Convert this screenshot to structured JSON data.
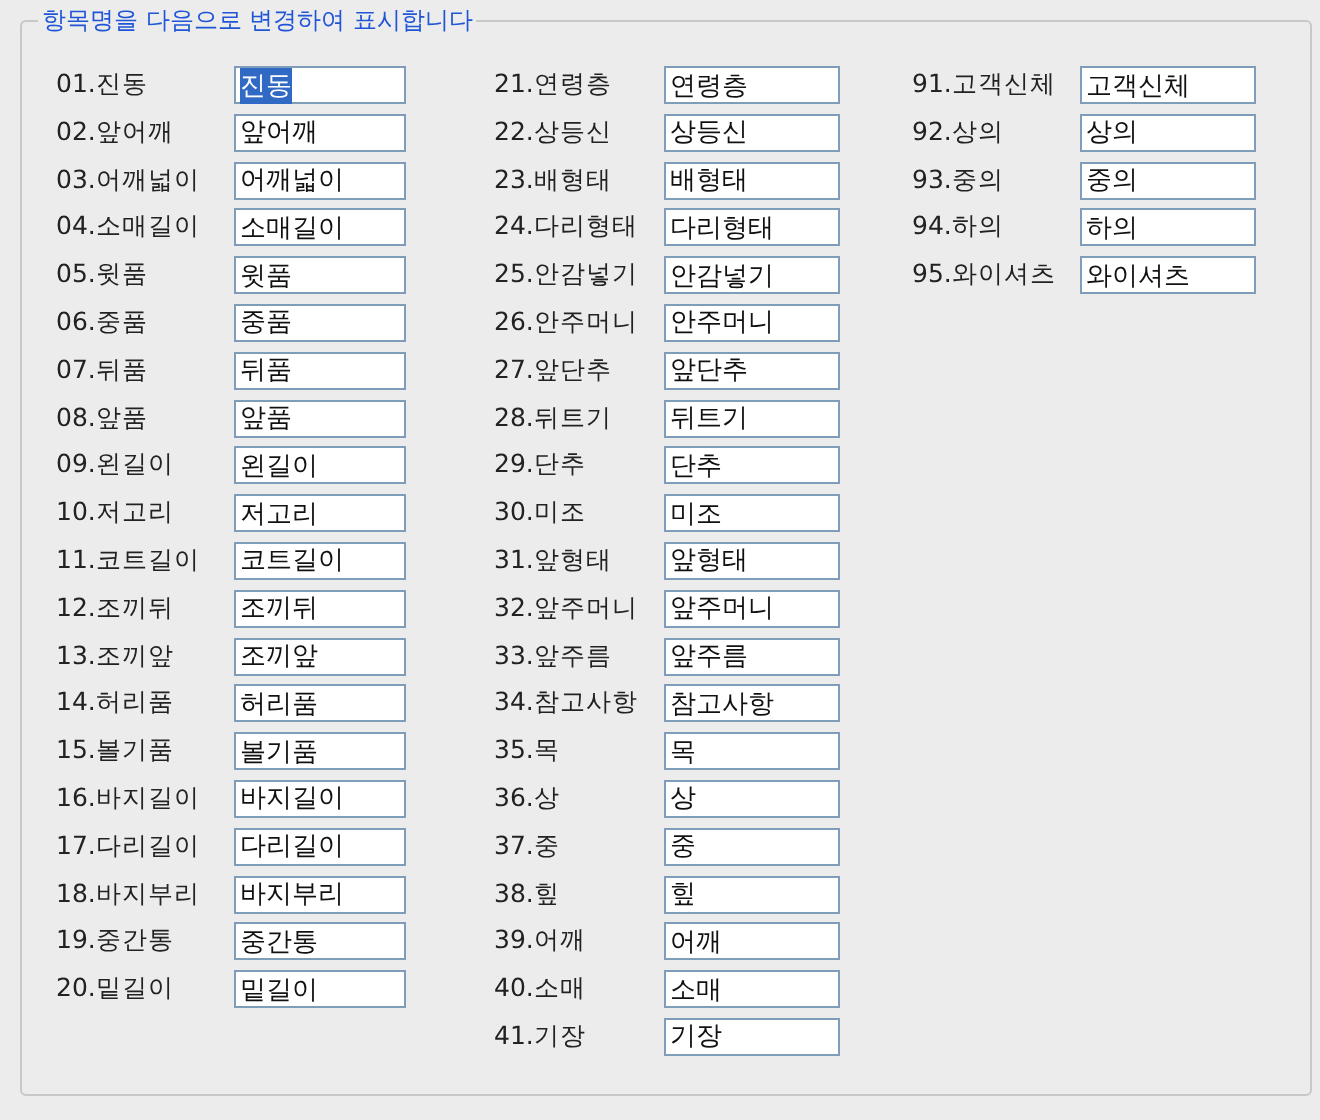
{
  "group": {
    "title": "항목명을 다음으로 변경하여 표시합니다"
  },
  "columns": [
    {
      "items": [
        {
          "label": "01.진동",
          "value": "진동",
          "selected": true
        },
        {
          "label": "02.앞어깨",
          "value": "앞어깨",
          "selected": false
        },
        {
          "label": "03.어깨넓이",
          "value": "어깨넓이",
          "selected": false
        },
        {
          "label": "04.소매길이",
          "value": "소매길이",
          "selected": false
        },
        {
          "label": "05.윗품",
          "value": "윗품",
          "selected": false
        },
        {
          "label": "06.중품",
          "value": "중품",
          "selected": false
        },
        {
          "label": "07.뒤품",
          "value": "뒤품",
          "selected": false
        },
        {
          "label": "08.앞품",
          "value": "앞품",
          "selected": false
        },
        {
          "label": "09.왼길이",
          "value": "왼길이",
          "selected": false
        },
        {
          "label": "10.저고리",
          "value": "저고리",
          "selected": false
        },
        {
          "label": "11.코트길이",
          "value": "코트길이",
          "selected": false
        },
        {
          "label": "12.조끼뒤",
          "value": "조끼뒤",
          "selected": false
        },
        {
          "label": "13.조끼앞",
          "value": "조끼앞",
          "selected": false
        },
        {
          "label": "14.허리품",
          "value": "허리품",
          "selected": false
        },
        {
          "label": "15.볼기품",
          "value": "볼기품",
          "selected": false
        },
        {
          "label": "16.바지길이",
          "value": "바지길이",
          "selected": false
        },
        {
          "label": "17.다리길이",
          "value": "다리길이",
          "selected": false
        },
        {
          "label": "18.바지부리",
          "value": "바지부리",
          "selected": false
        },
        {
          "label": "19.중간통",
          "value": "중간통",
          "selected": false
        },
        {
          "label": "20.밑길이",
          "value": "밑길이",
          "selected": false
        }
      ]
    },
    {
      "items": [
        {
          "label": "21.연령층",
          "value": "연령층",
          "selected": false
        },
        {
          "label": "22.상등신",
          "value": "상등신",
          "selected": false
        },
        {
          "label": "23.배형태",
          "value": "배형태",
          "selected": false
        },
        {
          "label": "24.다리형태",
          "value": "다리형태",
          "selected": false
        },
        {
          "label": "25.안감넣기",
          "value": "안감넣기",
          "selected": false
        },
        {
          "label": "26.안주머니",
          "value": "안주머니",
          "selected": false
        },
        {
          "label": "27.앞단추",
          "value": "앞단추",
          "selected": false
        },
        {
          "label": "28.뒤트기",
          "value": "뒤트기",
          "selected": false
        },
        {
          "label": "29.단추",
          "value": "단추",
          "selected": false
        },
        {
          "label": "30.미조",
          "value": "미조",
          "selected": false
        },
        {
          "label": "31.앞형태",
          "value": "앞형태",
          "selected": false
        },
        {
          "label": "32.앞주머니",
          "value": "앞주머니",
          "selected": false
        },
        {
          "label": "33.앞주름",
          "value": "앞주름",
          "selected": false
        },
        {
          "label": "34.참고사항",
          "value": "참고사항",
          "selected": false
        },
        {
          "label": "35.목",
          "value": "목",
          "selected": false
        },
        {
          "label": "36.상",
          "value": "상",
          "selected": false
        },
        {
          "label": "37.중",
          "value": "중",
          "selected": false
        },
        {
          "label": "38.힢",
          "value": "힢",
          "selected": false
        },
        {
          "label": "39.어깨",
          "value": "어깨",
          "selected": false
        },
        {
          "label": "40.소매",
          "value": "소매",
          "selected": false
        },
        {
          "label": "41.기장",
          "value": "기장",
          "selected": false
        }
      ]
    },
    {
      "items": [
        {
          "label": "91.고객신체",
          "value": "고객신체",
          "selected": false
        },
        {
          "label": "92.상의",
          "value": "상의",
          "selected": false
        },
        {
          "label": "93.중의",
          "value": "중의",
          "selected": false
        },
        {
          "label": "94.하의",
          "value": "하의",
          "selected": false
        },
        {
          "label": "95.와이셔츠",
          "value": "와이셔츠",
          "selected": false
        }
      ]
    }
  ]
}
